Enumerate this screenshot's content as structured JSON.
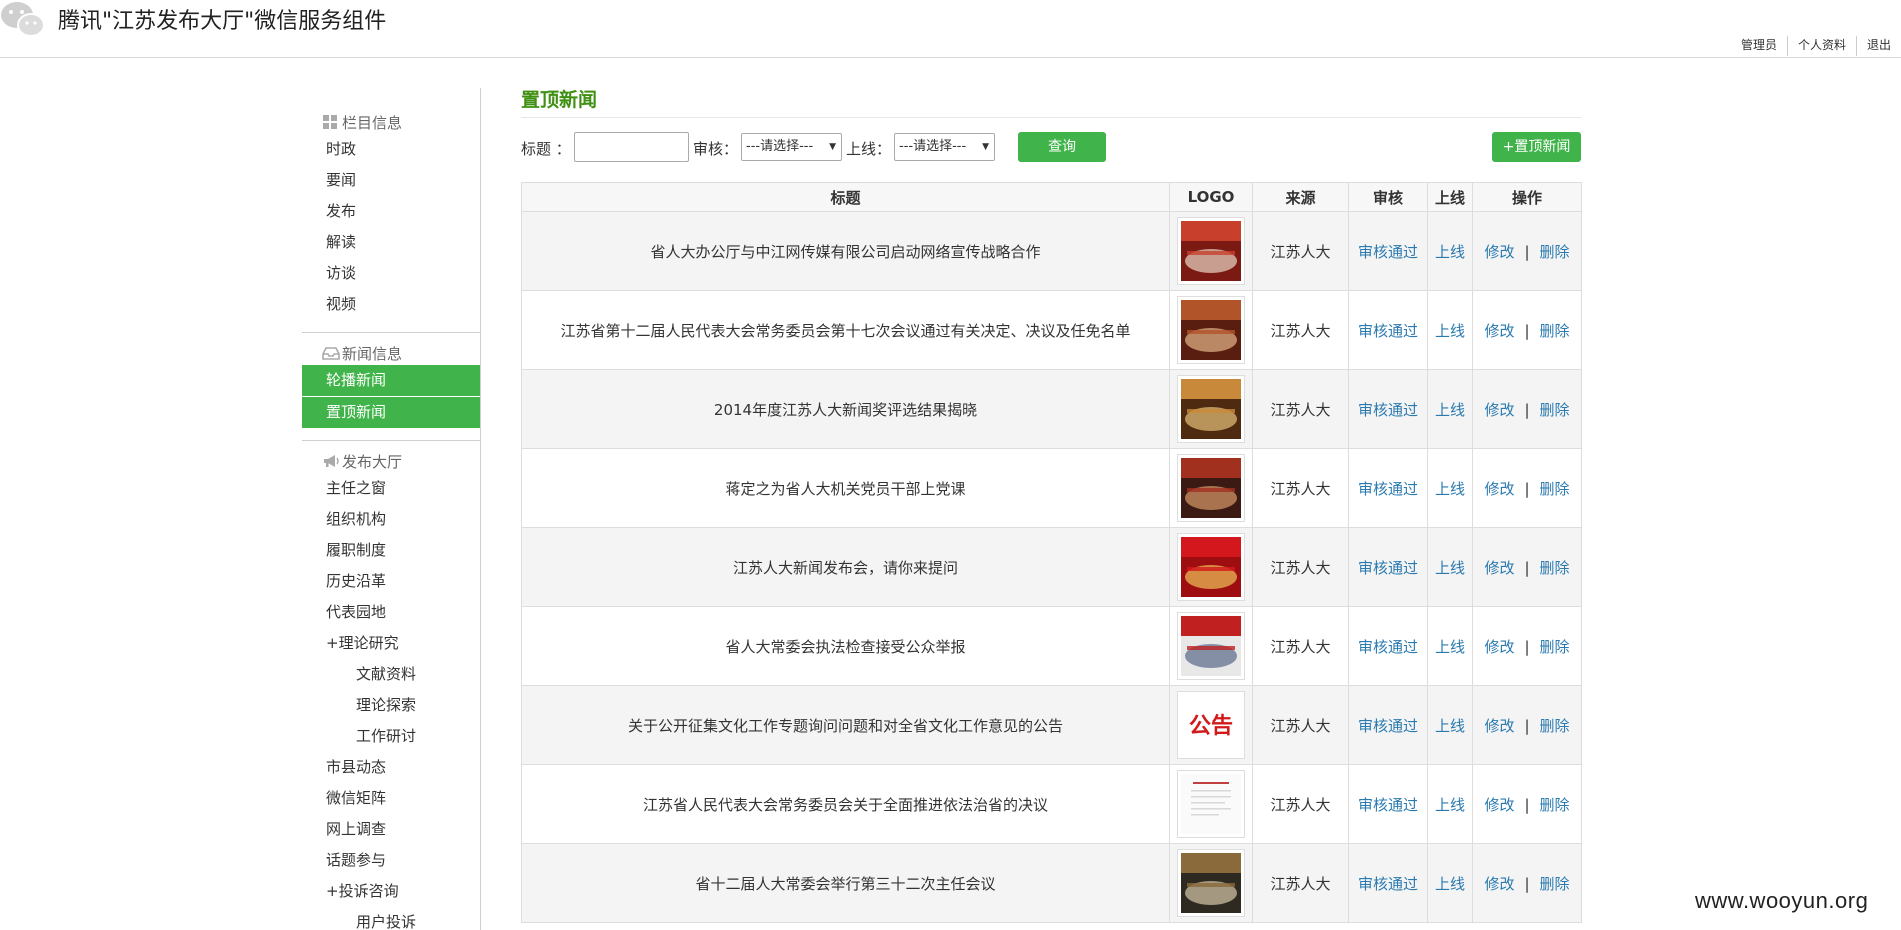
{
  "header": {
    "app_title": "腾讯\"江苏发布大厅\"微信服务组件",
    "nav": [
      "管理员",
      "个人资料",
      "退出"
    ]
  },
  "sidebar": {
    "groups": [
      {
        "label": "栏目信息",
        "icon": "grid-icon",
        "items": [
          {
            "label": "时政"
          },
          {
            "label": "要闻"
          },
          {
            "label": "发布"
          },
          {
            "label": "解读"
          },
          {
            "label": "访谈"
          },
          {
            "label": "视频"
          }
        ]
      },
      {
        "label": "新闻信息",
        "icon": "inbox-icon",
        "items": [
          {
            "label": "轮播新闻",
            "active": true
          },
          {
            "label": "置顶新闻",
            "active": true
          }
        ]
      },
      {
        "label": "发布大厅",
        "icon": "megaphone-icon",
        "items": [
          {
            "label": "主任之窗"
          },
          {
            "label": "组织机构"
          },
          {
            "label": "履职制度"
          },
          {
            "label": "历史沿革"
          },
          {
            "label": "代表园地"
          },
          {
            "label": "+理论研究"
          },
          {
            "label": "文献资料",
            "sub": true
          },
          {
            "label": "理论探索",
            "sub": true
          },
          {
            "label": "工作研讨",
            "sub": true
          },
          {
            "label": "市县动态"
          },
          {
            "label": "微信矩阵"
          },
          {
            "label": "网上调查"
          },
          {
            "label": "话题参与"
          },
          {
            "label": "+投诉咨询"
          },
          {
            "label": "用户投诉",
            "sub": true
          }
        ]
      }
    ]
  },
  "main": {
    "page_title": "置顶新闻",
    "filter": {
      "title_label": "标题 ：",
      "title_value": "",
      "review_label": "审核：",
      "review_selected": "---请选择---",
      "online_label": "上线：",
      "online_selected": "---请选择---",
      "query_label": "查询",
      "add_label": "+置顶新闻"
    },
    "table": {
      "headers": [
        "标题",
        "LOGO",
        "来源",
        "审核",
        "上线",
        "操作"
      ],
      "action_edit": "修改",
      "action_delete": "删除",
      "action_sep": "|",
      "rows": [
        {
          "title": "省人大办公厅与中江网传媒有限公司启动网络宣传战略合作",
          "source": "江苏人大",
          "review": "审核通过",
          "online": "上线",
          "thumb": "meeting-photo"
        },
        {
          "title": "江苏省第十二届人民代表大会常务委员会第十七次会议通过有关决定、决议及任免名单",
          "source": "江苏人大",
          "review": "审核通过",
          "online": "上线",
          "thumb": "session-photo"
        },
        {
          "title": "2014年度江苏人大新闻奖评选结果揭晓",
          "source": "江苏人大",
          "review": "审核通过",
          "online": "上线",
          "thumb": "hall-photo"
        },
        {
          "title": "蒋定之为省人大机关党员干部上党课",
          "source": "江苏人大",
          "review": "审核通过",
          "online": "上线",
          "thumb": "auditorium-photo"
        },
        {
          "title": "江苏人大新闻发布会，请你来提问",
          "source": "江苏人大",
          "review": "审核通过",
          "online": "上线",
          "thumb": "red-poster"
        },
        {
          "title": "省人大常委会执法检查接受公众举报",
          "source": "江苏人大",
          "review": "审核通过",
          "online": "上线",
          "thumb": "report-poster"
        },
        {
          "title": "关于公开征集文化工作专题询问问题和对全省文化工作意见的公告",
          "source": "江苏人大",
          "review": "审核通过",
          "online": "上线",
          "thumb": "notice-text",
          "thumb_text": "公告"
        },
        {
          "title": "江苏省人民代表大会常务委员会关于全面推进依法治省的决议",
          "source": "江苏人大",
          "review": "审核通过",
          "online": "上线",
          "thumb": "document-scan"
        },
        {
          "title": "省十二届人大常委会举行第三十二次主任会议",
          "source": "江苏人大",
          "review": "审核通过",
          "online": "上线",
          "thumb": "conference-photo"
        }
      ]
    }
  },
  "watermark": "www.wooyun.org",
  "colors": {
    "accent_green": "#40b44a",
    "title_green": "#3f8f12",
    "link_blue": "#2a7ab0"
  }
}
